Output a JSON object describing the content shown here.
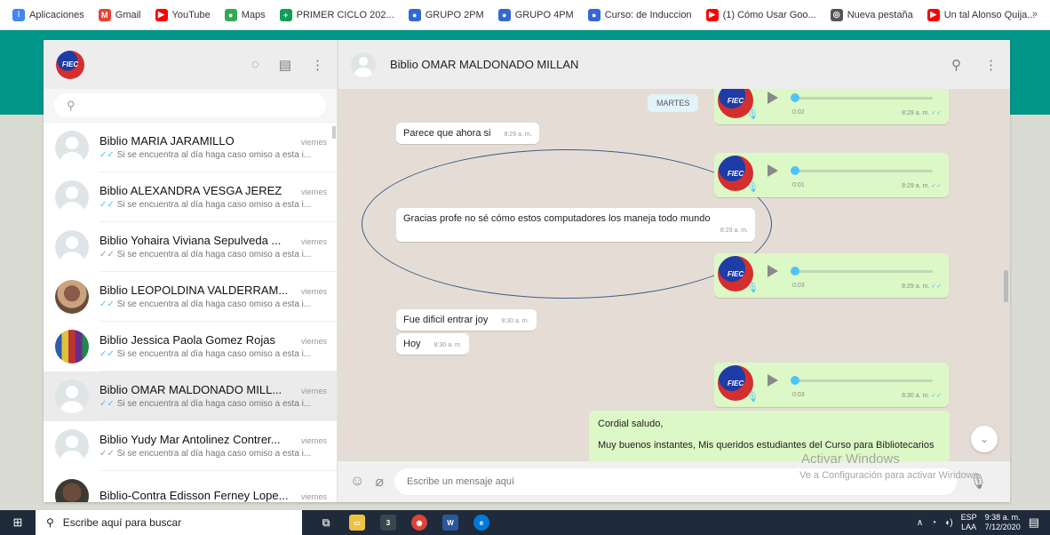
{
  "bookmarks": [
    {
      "label": "Aplicaciones",
      "icon": "apps-grid-icon",
      "color": "#4285f4",
      "glyph": "⁝"
    },
    {
      "label": "Gmail",
      "icon": "gmail-icon",
      "color": "#ea4335",
      "glyph": "M"
    },
    {
      "label": "YouTube",
      "icon": "youtube-icon",
      "color": "#ff0000",
      "glyph": "▶"
    },
    {
      "label": "Maps",
      "icon": "maps-icon",
      "color": "#34a853",
      "glyph": "●"
    },
    {
      "label": "PRIMER CICLO 202...",
      "icon": "classroom-icon",
      "color": "#0f9d58",
      "glyph": "+"
    },
    {
      "label": "GRUPO 2PM",
      "icon": "group-icon",
      "color": "#3367d6",
      "glyph": "●"
    },
    {
      "label": "GRUPO 4PM",
      "icon": "group-icon",
      "color": "#3367d6",
      "glyph": "●"
    },
    {
      "label": "Curso: de Induccion",
      "icon": "group-icon",
      "color": "#3367d6",
      "glyph": "●"
    },
    {
      "label": "(1) Cómo Usar Goo...",
      "icon": "youtube-icon",
      "color": "#ff0000",
      "glyph": "▶"
    },
    {
      "label": "Nueva pestaña",
      "icon": "globe-icon",
      "color": "#555555",
      "glyph": "◎"
    },
    {
      "label": "Un tal Alonso Quija...",
      "icon": "youtube-icon",
      "color": "#ff0000",
      "glyph": "▶"
    }
  ],
  "bookmarks_more": "»",
  "sidebar": {
    "logo_text": "FIEC",
    "search_placeholder": "",
    "chats": [
      {
        "name": "Biblio MARIA JARAMILLO",
        "time": "viernes",
        "preview": "Si se encuentra al día haga caso omiso a esta i...",
        "read": true,
        "avatar": "default"
      },
      {
        "name": "Biblio ALEXANDRA  VESGA JEREZ",
        "time": "viernes",
        "preview": "Si se encuentra al día haga caso omiso a esta i...",
        "read": true,
        "avatar": "default"
      },
      {
        "name": "Biblio Yohaira Viviana Sepulveda ...",
        "time": "viernes",
        "preview": "Si se encuentra al día haga caso omiso a esta i...",
        "read": false,
        "avatar": "default"
      },
      {
        "name": "Biblio LEOPOLDINA  VALDERRAM...",
        "time": "viernes",
        "preview": "Si se encuentra al día haga caso omiso a esta i...",
        "read": true,
        "avatar": "photo1"
      },
      {
        "name": "Biblio Jessica Paola Gomez Rojas",
        "time": "viernes",
        "preview": "Si se encuentra al día haga caso omiso a esta i...",
        "read": true,
        "avatar": "photo2"
      },
      {
        "name": "Biblio OMAR MALDONADO MILL...",
        "time": "viernes",
        "preview": "Si se encuentra al día haga caso omiso a esta i...",
        "read": true,
        "avatar": "default",
        "active": true
      },
      {
        "name": "Biblio Yudy Mar Antolinez Contrer...",
        "time": "viernes",
        "preview": "Si se encuentra al día haga caso omiso a esta i...",
        "read": false,
        "avatar": "default"
      },
      {
        "name": "Biblio-Contra Edisson Ferney Lope...",
        "time": "viernes",
        "preview": "",
        "read": true,
        "avatar": "photo3"
      }
    ]
  },
  "conversation": {
    "title": "Biblio OMAR MALDONADO MILLAN",
    "day_label": "MARTES",
    "messages": {
      "m1": {
        "text": "Parece que ahora si",
        "time": "8:29 a. m."
      },
      "m2": {
        "text": "Gracias profe no sé cómo estos computadores los maneja todo mundo",
        "time": "8:29 a. m."
      },
      "m3": {
        "text": "Fue dificil entrar joy",
        "time": "8:30 a. m."
      },
      "m4": {
        "text": "Hoy",
        "time": "8:30 a. m."
      },
      "m5_line1": "Cordial saludo,",
      "m5_line2": "Muy buenos instantes, Mis queridos estudiantes del Curso para Bibliotecarios"
    },
    "audios": [
      {
        "duration": "0:02",
        "time": "8:29 a. m.",
        "progress": 0
      },
      {
        "duration": "0:01",
        "time": "8:29 a. m.",
        "progress": 0
      },
      {
        "duration": "0:03",
        "time": "8:29 a. m.",
        "progress": 0
      },
      {
        "duration": "0:03",
        "time": "8:30 a. m.",
        "progress": 0
      }
    ],
    "compose_placeholder": "Escribe un mensaje aquí"
  },
  "watermark": {
    "line1": "Activar Windows",
    "line2": "Ve a Configuración para activar Windows."
  },
  "taskbar": {
    "search_text": "Escribe aquí para buscar",
    "lang1": "ESP",
    "lang2": "LAA",
    "time": "9:38 a. m.",
    "date": "7/12/2020"
  },
  "colors": {
    "header": "#009688",
    "outgoing": "#dcf8c6",
    "read_tick": "#4fc3f7"
  }
}
